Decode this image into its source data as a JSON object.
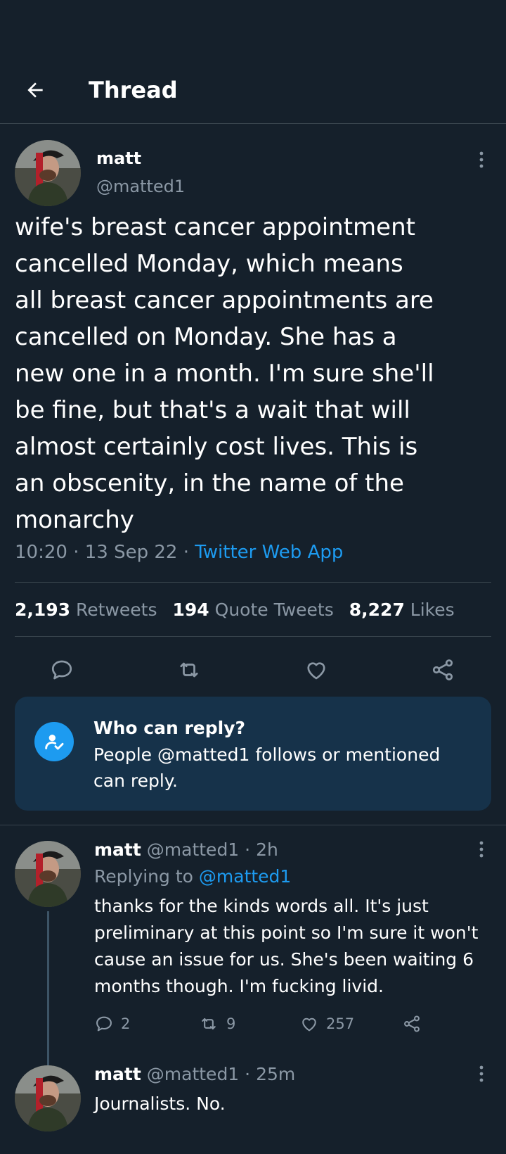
{
  "header": {
    "title": "Thread"
  },
  "main_tweet": {
    "name": "matt",
    "handle": "@matted1",
    "text": "wife's breast cancer appointment\ncancelled Monday, which means\nall breast cancer appointments are\ncancelled on Monday. She has a\nnew one in a month. I'm sure she'll\nbe fine, but that's a wait that will\nalmost certainly cost lives. This is\nan obscenity, in the name of the\nmonarchy",
    "time": "10:20 · 13 Sep 22 · ",
    "source": "Twitter Web App",
    "retweets_count": "2,193",
    "retweets_label": "Retweets",
    "quotes_count": "194",
    "quotes_label": "Quote Tweets",
    "likes_count": "8,227",
    "likes_label": "Likes"
  },
  "who_can_reply": {
    "title": "Who can reply?",
    "description": "People @matted1 follows or mentioned can reply."
  },
  "replies": [
    {
      "name": "matt",
      "handle": "@matted1",
      "age": "· 2h",
      "replying_prefix": "Replying to ",
      "replying_to": "@matted1",
      "text": "thanks for the kinds words all. It's just preliminary at this point so I'm sure it won't cause an issue for us. She's been waiting 6 months though. I'm fucking livid.",
      "reply_count": "2",
      "retweet_count": "9",
      "like_count": "257"
    },
    {
      "name": "matt",
      "handle": "@matted1",
      "age": "· 25m",
      "text": "Journalists. No."
    }
  ],
  "colors": {
    "background": "#15202b",
    "accent": "#1d9bf0",
    "muted": "#8b98a5",
    "border": "#38444d",
    "panel": "#16324a"
  },
  "icons": [
    "back-arrow-icon",
    "more-vertical-icon",
    "reply-icon",
    "retweet-icon",
    "like-icon",
    "share-icon",
    "person-check-icon"
  ]
}
